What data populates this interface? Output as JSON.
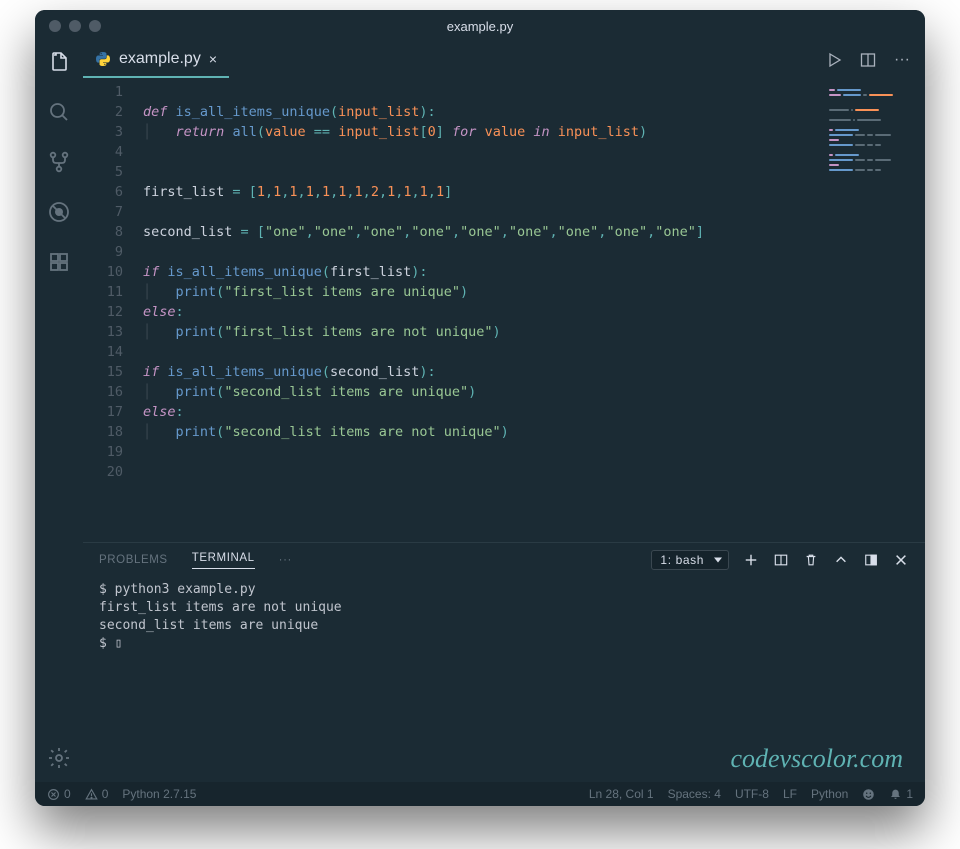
{
  "window_title": "example.py",
  "tab": {
    "label": "example.py",
    "lang": "python"
  },
  "code_lines": [
    "",
    "def is_all_items_unique(input_list):",
    "    return all(value == input_list[0] for value in input_list)",
    "",
    "",
    "first_list = [1,1,1,1,1,1,1,2,1,1,1,1]",
    "",
    "second_list = [\"one\",\"one\",\"one\",\"one\",\"one\",\"one\",\"one\",\"one\",\"one\"]",
    "",
    "if is_all_items_unique(first_list):",
    "    print(\"first_list items are unique\")",
    "else:",
    "    print(\"first_list items are not unique\")",
    "",
    "if is_all_items_unique(second_list):",
    "    print(\"second_list items are unique\")",
    "else:",
    "    print(\"second_list items are not unique\")",
    "",
    ""
  ],
  "line_count": 20,
  "panel": {
    "tabs": {
      "problems": "PROBLEMS",
      "terminal": "TERMINAL",
      "more": "···"
    },
    "active_tab": "TERMINAL",
    "terminal_selector": "1: bash"
  },
  "terminal": {
    "command": "$ python3 example.py",
    "out1": "first_list items are not unique",
    "out2": "second_list items are unique",
    "prompt": "$ ▯"
  },
  "status": {
    "errors": "0",
    "warnings": "0",
    "python_ver": "Python 2.7.15",
    "cursor": "Ln 28, Col 1",
    "spaces": "Spaces: 4",
    "encoding": "UTF-8",
    "eol": "LF",
    "lang": "Python",
    "notif": "1"
  },
  "watermark": "codevscolor.com"
}
